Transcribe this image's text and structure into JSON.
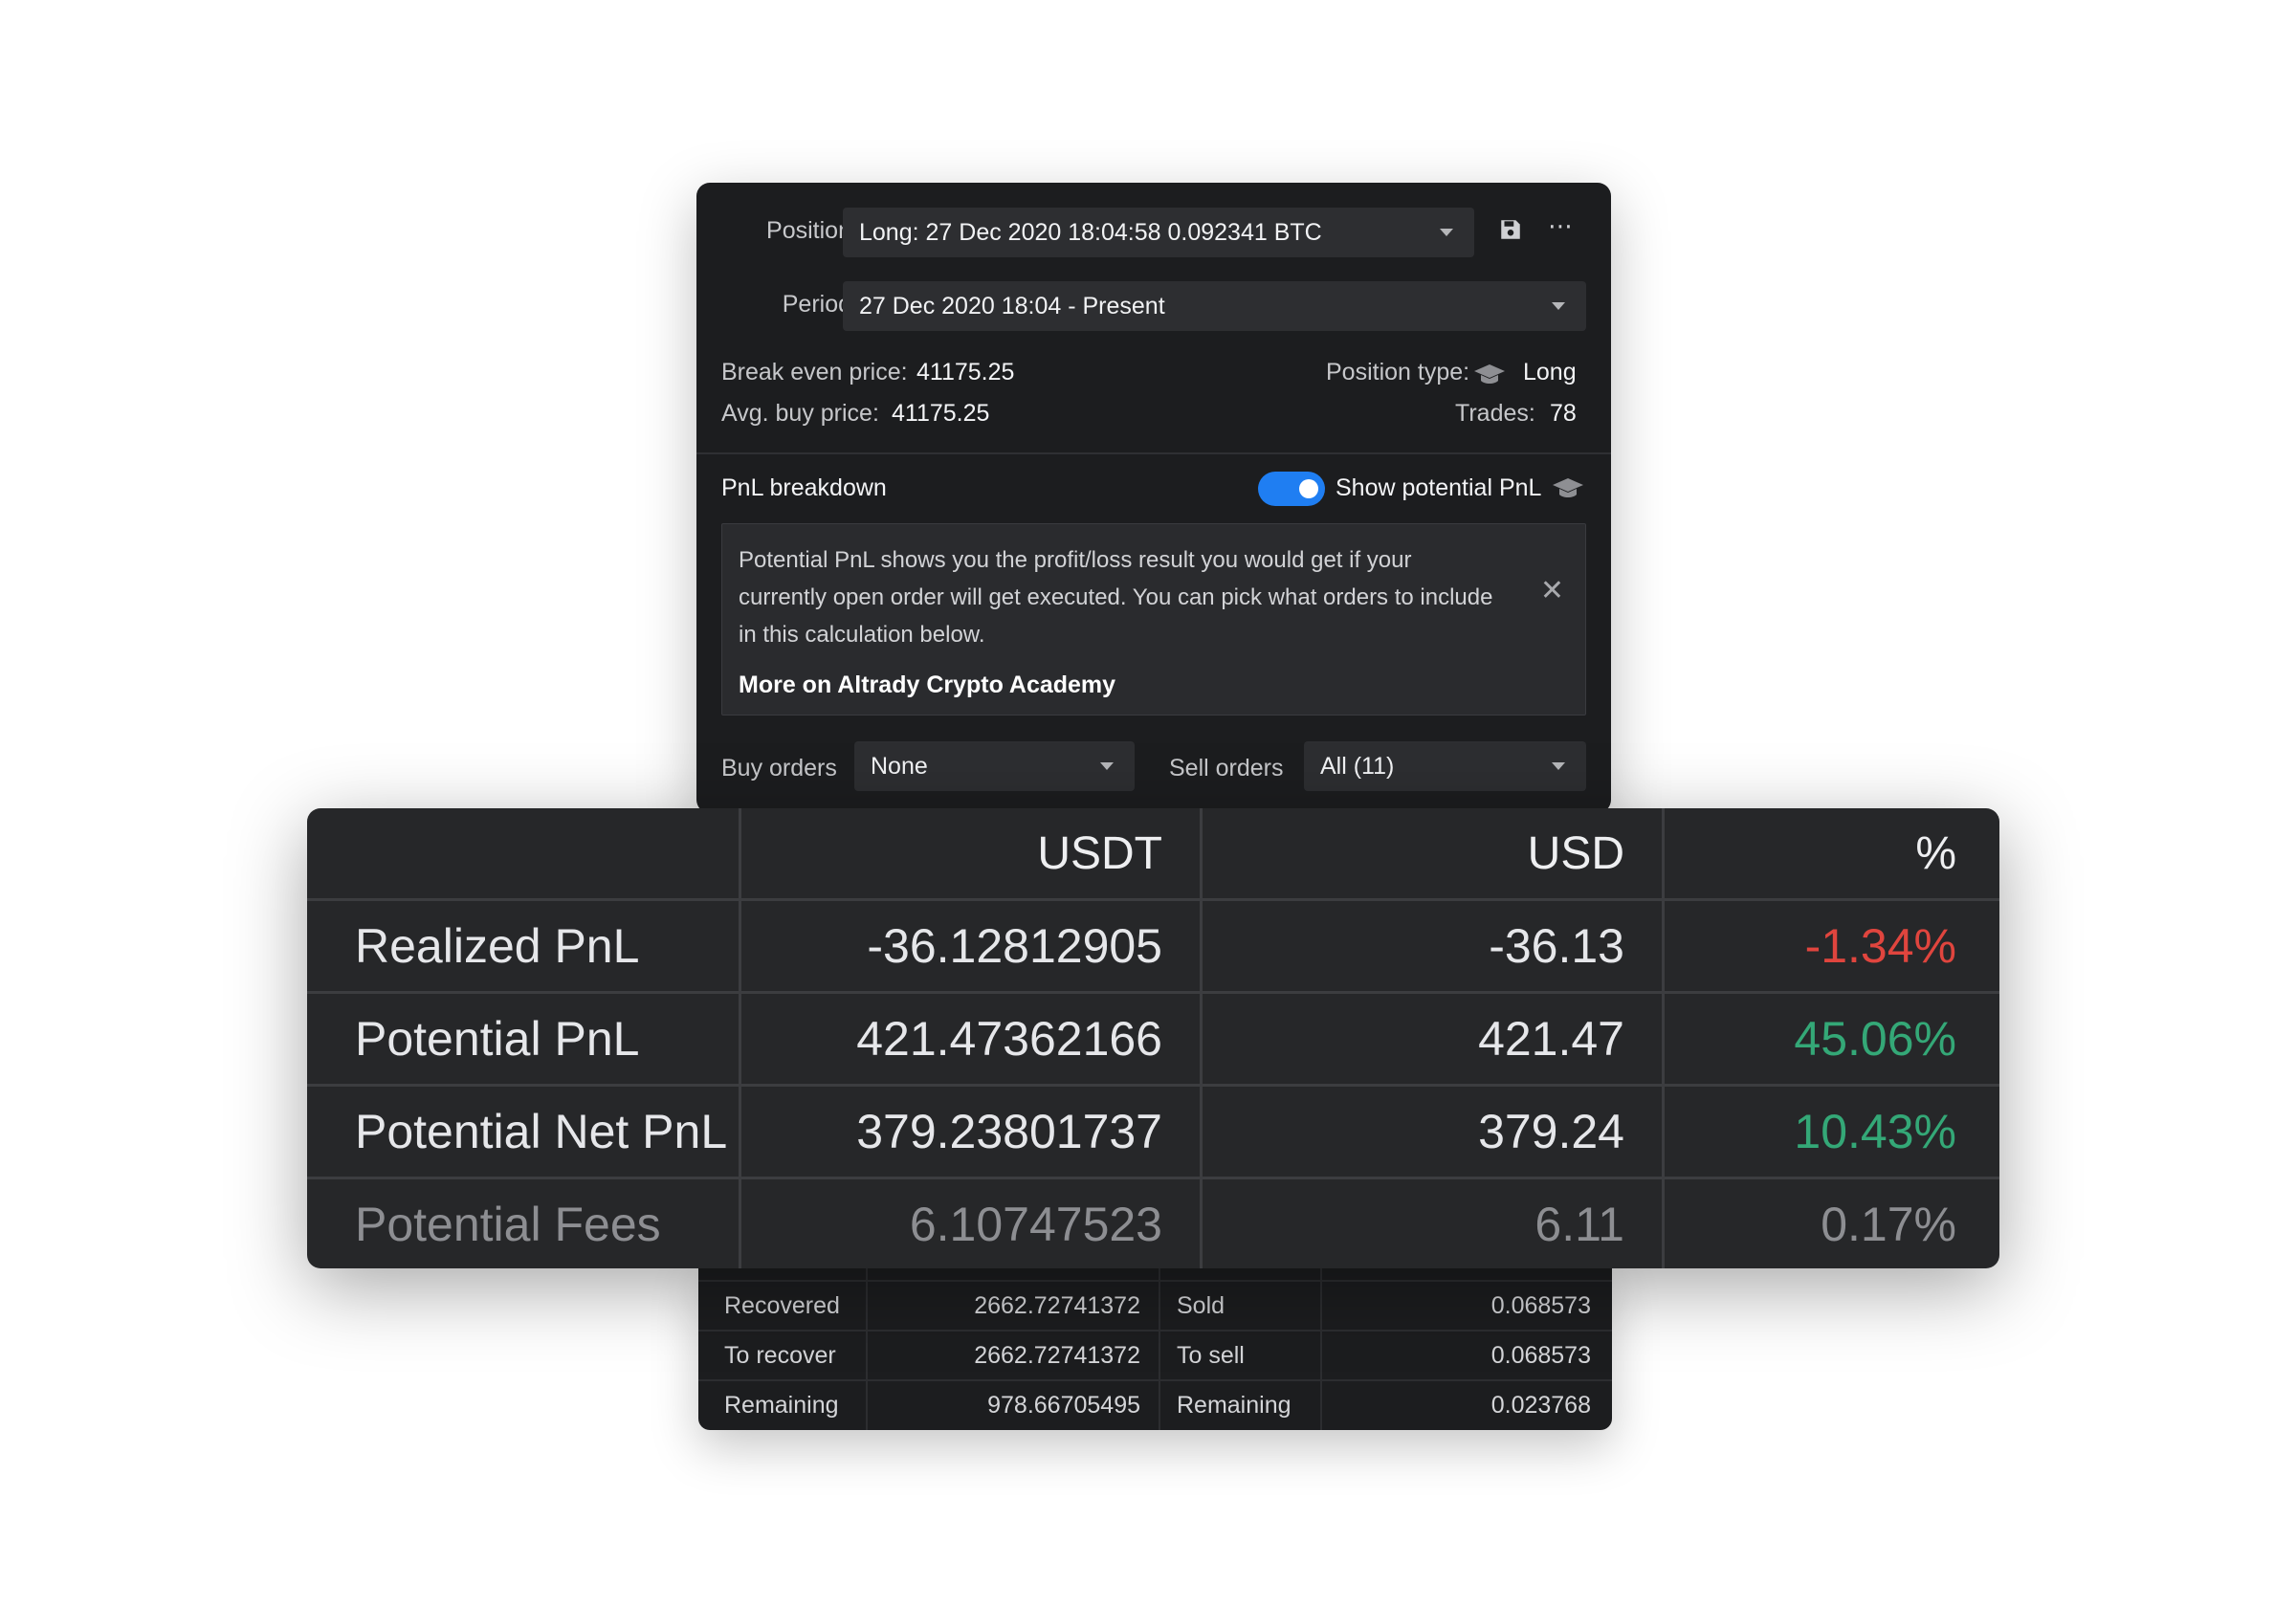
{
  "panel": {
    "position": {
      "label": "Position",
      "value": "Long: 27 Dec 2020 18:04:58 0.092341 BTC"
    },
    "period": {
      "label": "Period",
      "value": "27 Dec 2020 18:04 - Present"
    },
    "break_even": {
      "label": "Break even price:",
      "value": "41175.25"
    },
    "avg_buy": {
      "label": "Avg. buy price:",
      "value": "41175.25"
    },
    "position_type": {
      "label": "Position type:",
      "value": "Long"
    },
    "trades": {
      "label": "Trades:",
      "value": "78"
    },
    "pnl_breakdown": "PnL breakdown",
    "show_potential": {
      "label": "Show potential PnL",
      "enabled": true
    },
    "notice": {
      "text": "Potential PnL shows you the profit/loss result you would get if your currently open order will get executed. You can pick what orders to include in this calculation below.",
      "link": "More on Altrady Crypto Academy"
    },
    "buy_orders": {
      "label": "Buy orders",
      "value": "None"
    },
    "sell_orders": {
      "label": "Sell orders",
      "value": "All (11)"
    }
  },
  "big_table": {
    "headers": [
      "",
      "USDT",
      "USD",
      "%"
    ],
    "rows": [
      {
        "label": "Realized PnL",
        "usdt": "-36.12812905",
        "usd": "-36.13",
        "pct": "-1.34%"
      },
      {
        "label": "Potential PnL",
        "usdt": "421.47362166",
        "usd": "421.47",
        "pct": "45.06%"
      },
      {
        "label": "Potential Net PnL",
        "usdt": "379.23801737",
        "usd": "379.24",
        "pct": "10.43%"
      },
      {
        "label": "Potential Fees",
        "usdt": "6.10747523",
        "usd": "6.11",
        "pct": "0.17%"
      }
    ]
  },
  "mini_table": {
    "rows": [
      {
        "l1": "Recovered",
        "v1": "2662.72741372",
        "l2": "Sold",
        "v2": "0.068573"
      },
      {
        "l1": "To recover",
        "v1": "2662.72741372",
        "l2": "To sell",
        "v2": "0.068573"
      },
      {
        "l1": "Remaining",
        "v1": "978.66705495",
        "l2": "Remaining",
        "v2": "0.023768"
      }
    ]
  },
  "colors": {
    "negative": "#e0453e",
    "positive": "#34a877",
    "toggle": "#1f7ef2"
  },
  "icons": [
    "save-icon",
    "more-icon",
    "graduation-cap-icon",
    "close-icon",
    "chevron-down-icon"
  ]
}
